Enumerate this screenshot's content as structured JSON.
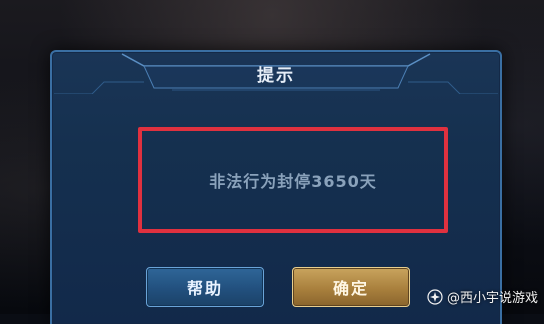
{
  "dialog": {
    "title": "提示",
    "message": "非法行为封停3650天"
  },
  "buttons": {
    "help_label": "帮助",
    "confirm_label": "确定"
  },
  "watermark": {
    "text": "@西小宇说游戏",
    "icon": "sparkle-icon"
  },
  "colors": {
    "dialog_bg": "#15304f",
    "dialog_border": "#3a6fa3",
    "highlight_border": "#e0313f",
    "help_button": "#22507e",
    "confirm_button": "#a9803d"
  }
}
